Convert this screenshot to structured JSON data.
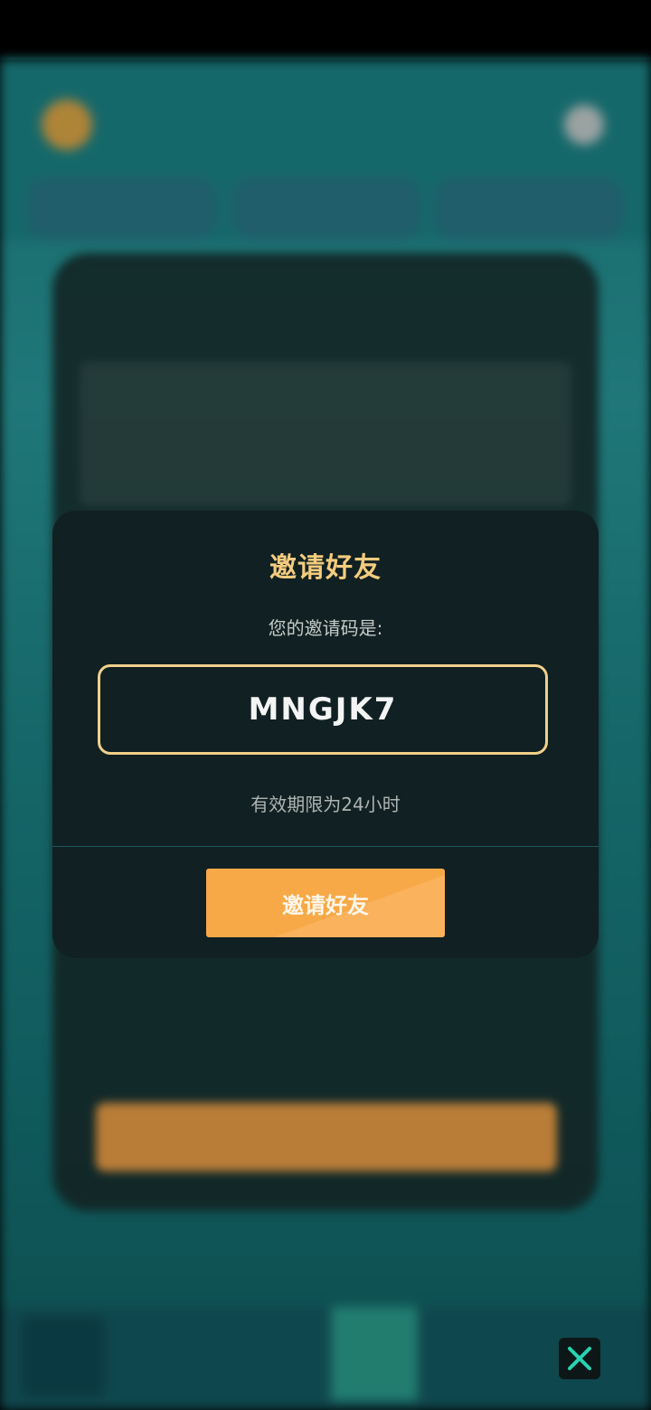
{
  "dialog": {
    "title": "邀请好友",
    "code_label": "您的邀请码是:",
    "invite_code": "MNGJK7",
    "expiry_text": "有效期限为24小时",
    "invite_button_label": "邀请好友"
  },
  "colors": {
    "title": "#f4cc7e",
    "code_border": "#f1d08a",
    "button": "#f8a947",
    "dialog_bg": "#112022",
    "close_icon": "#27d3b0"
  },
  "icons": {
    "close": "close-icon"
  }
}
